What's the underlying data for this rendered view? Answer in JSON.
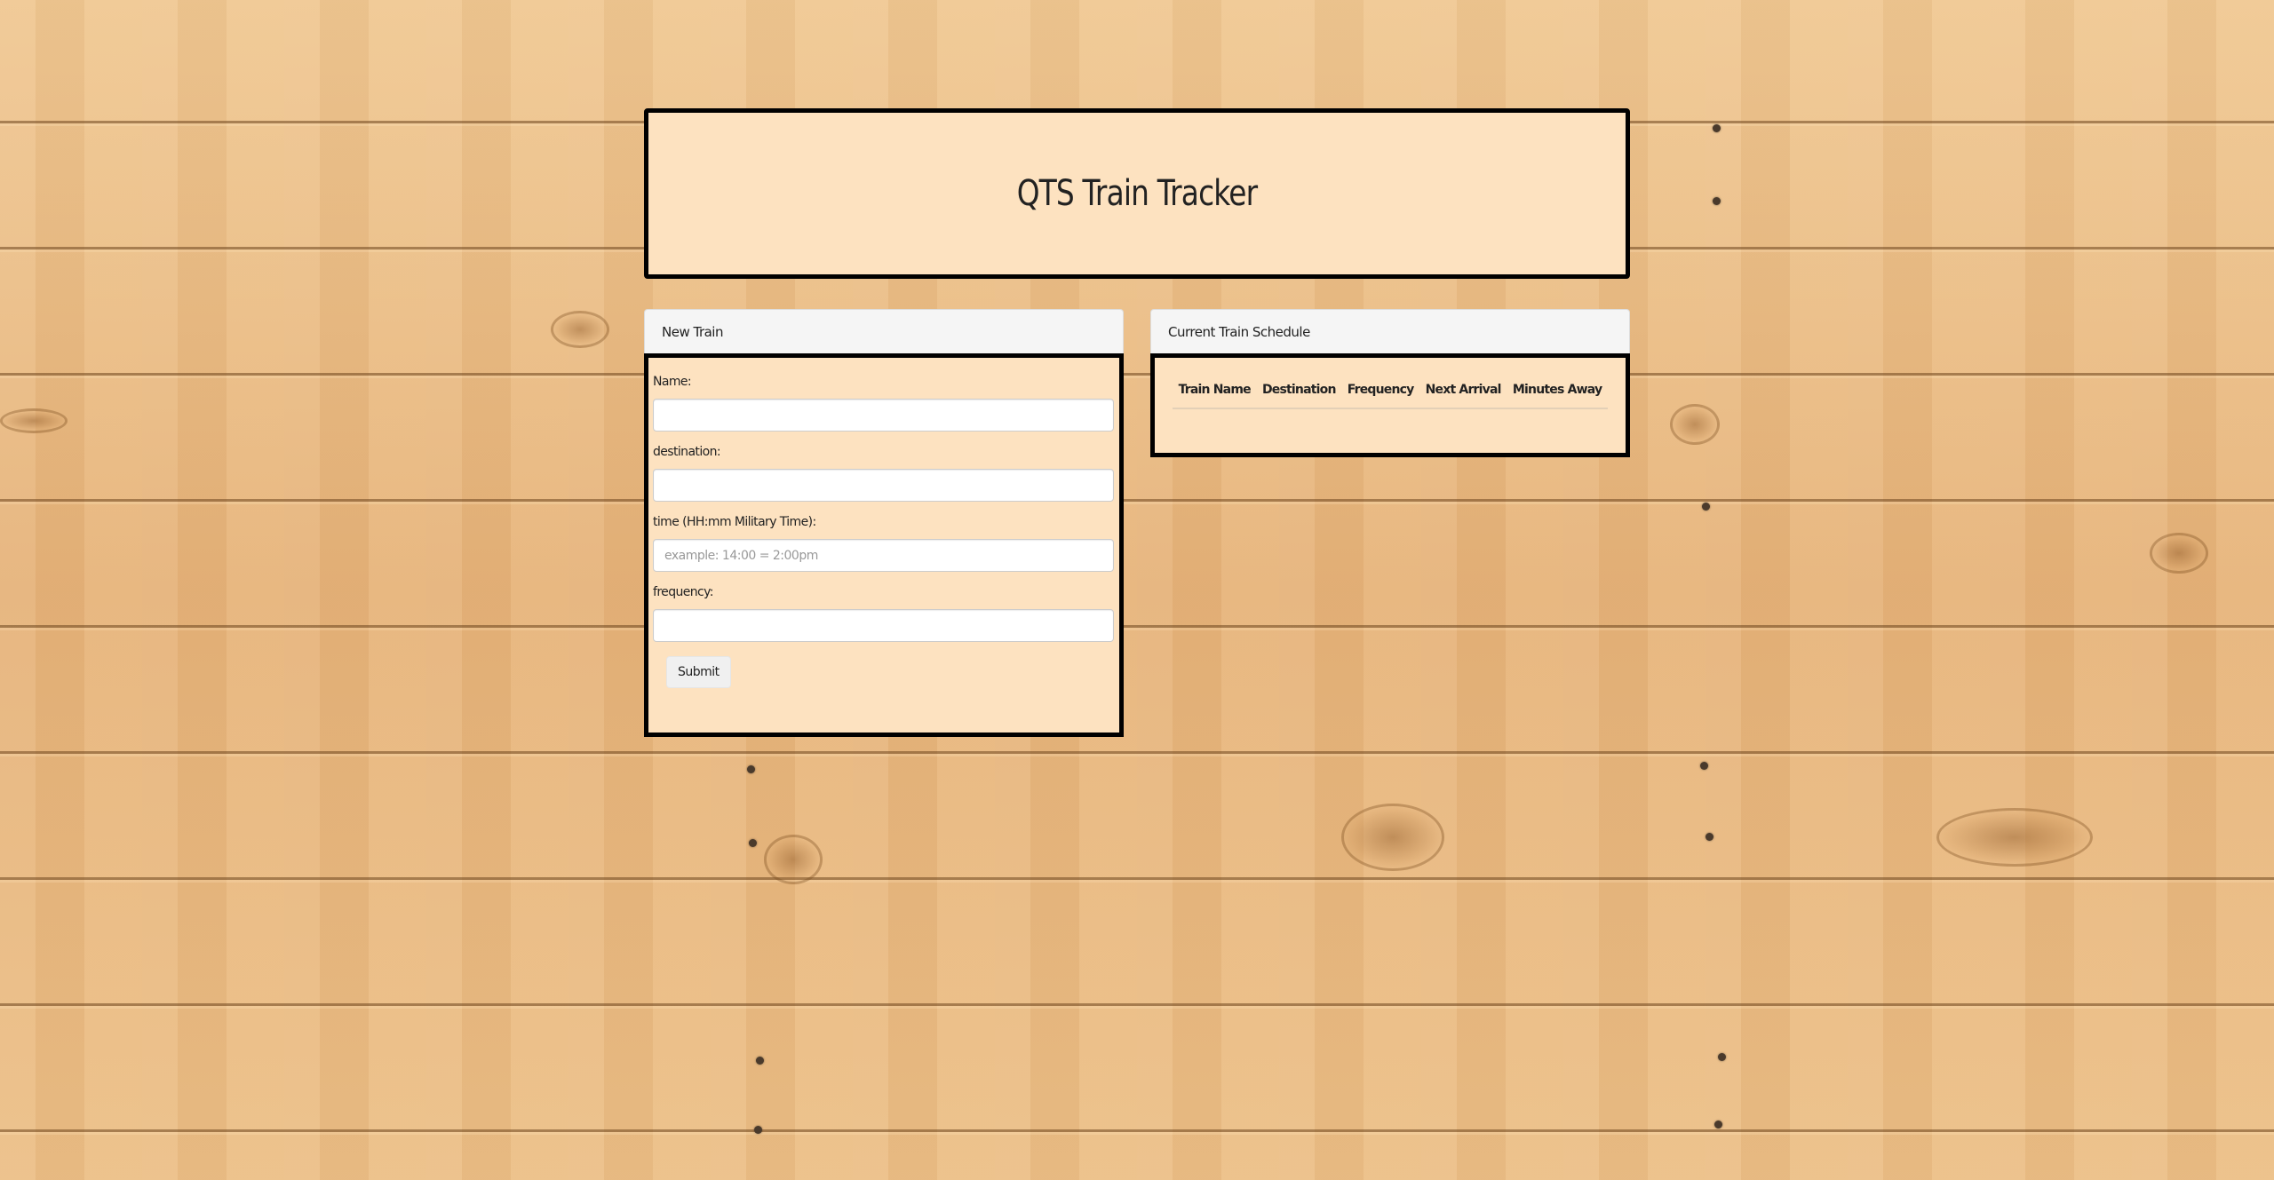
{
  "header": {
    "title": "QTS Train Tracker"
  },
  "new_train": {
    "heading": "New Train",
    "fields": [
      {
        "label": "Name:",
        "value": "",
        "placeholder": ""
      },
      {
        "label": "destination:",
        "value": "",
        "placeholder": ""
      },
      {
        "label": "time (HH:mm Military Time):",
        "value": "",
        "placeholder": "example: 14:00 = 2:00pm"
      },
      {
        "label": "frequency:",
        "value": "",
        "placeholder": ""
      }
    ],
    "submit_label": "Submit"
  },
  "schedule": {
    "heading": "Current Train Schedule",
    "columns": [
      "Train Name",
      "Destination",
      "Frequency",
      "Next Arrival",
      "Minutes Away"
    ],
    "rows": []
  }
}
